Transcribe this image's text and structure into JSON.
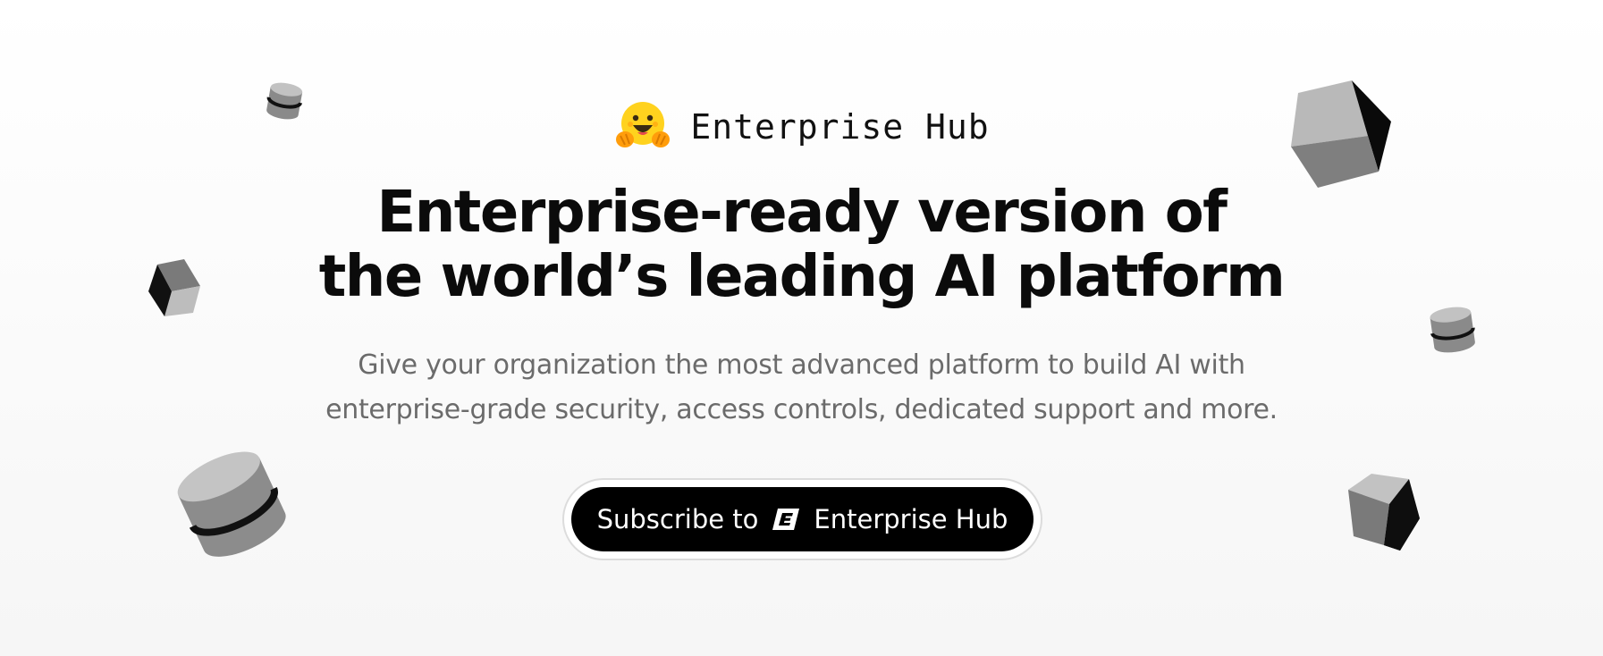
{
  "brand": {
    "logo_icon": "hugging-face-emoji-icon",
    "name": "Enterprise Hub"
  },
  "hero": {
    "headline_line1": "Enterprise-ready version of",
    "headline_line2": "the world’s leading AI platform",
    "subtitle_line1": "Give your organization the most advanced platform to build AI with",
    "subtitle_line2": "enterprise-grade security, access controls, dedicated support and more."
  },
  "cta": {
    "label_prefix": "Subscribe to",
    "badge_icon": "enterprise-e-icon",
    "label_suffix": "Enterprise Hub"
  },
  "decorations": {
    "icons": [
      "cylinder-icon",
      "cube-icon"
    ]
  },
  "colors": {
    "text": "#0b0b0b",
    "subtitle": "#6b6b6b",
    "button_bg": "#000000",
    "button_text": "#ffffff",
    "brand_yellow": "#FFD21E"
  }
}
